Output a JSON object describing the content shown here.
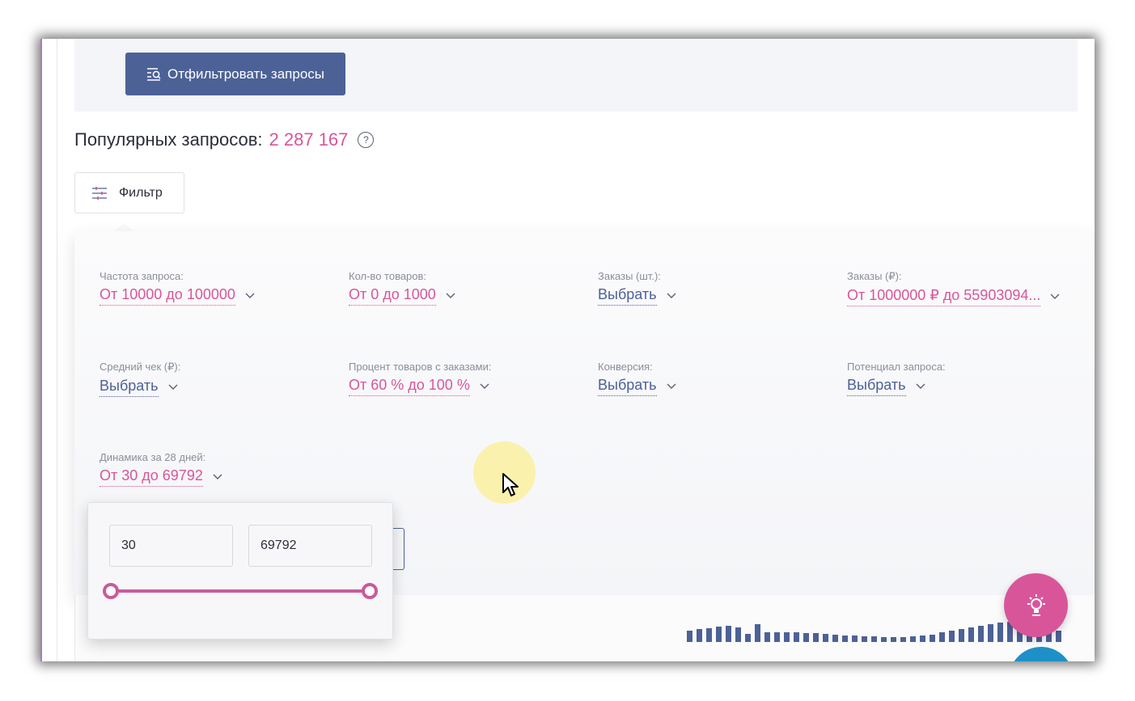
{
  "top_button": {
    "label": "Отфильтровать запросы",
    "icon": "filter-search-icon"
  },
  "popular": {
    "label": "Популярных запросов:",
    "count": "2 287 167",
    "help_symbol": "?"
  },
  "filter_toggle": {
    "label": "Фильтр",
    "icon": "sliders-icon"
  },
  "filters": [
    {
      "label": "Частота запроса:",
      "value": "От 10000 до 100000"
    },
    {
      "label": "Кол-во товаров:",
      "value": "От 0 до 1000"
    },
    {
      "label": "Заказы (шт.):",
      "value": "Выбрать"
    },
    {
      "label": "Заказы (₽):",
      "value": "От 1000000 ₽ до 55903094..."
    },
    {
      "label": "Средний чек (₽):",
      "value": "Выбрать"
    },
    {
      "label": "Процент товаров с заказами:",
      "value": "От 60 % до 100 %"
    },
    {
      "label": "Конверсия:",
      "value": "Выбрать"
    },
    {
      "label": "Потенциал запроса:",
      "value": "Выбрать"
    },
    {
      "label": "Динамика за 28 дней:",
      "value": "От 30 до 69792"
    }
  ],
  "range": {
    "min_value": "30",
    "max_value": "69792",
    "slider_min_fraction": 0.0,
    "slider_max_fraction": 1.0
  },
  "colors": {
    "accent_pink": "#d9559a",
    "accent_blue": "#4c6196",
    "chat_blue": "#1e90c8"
  },
  "fabs": {
    "idea_icon": "lightbulb-icon",
    "chat_icon": "chat-icon"
  }
}
